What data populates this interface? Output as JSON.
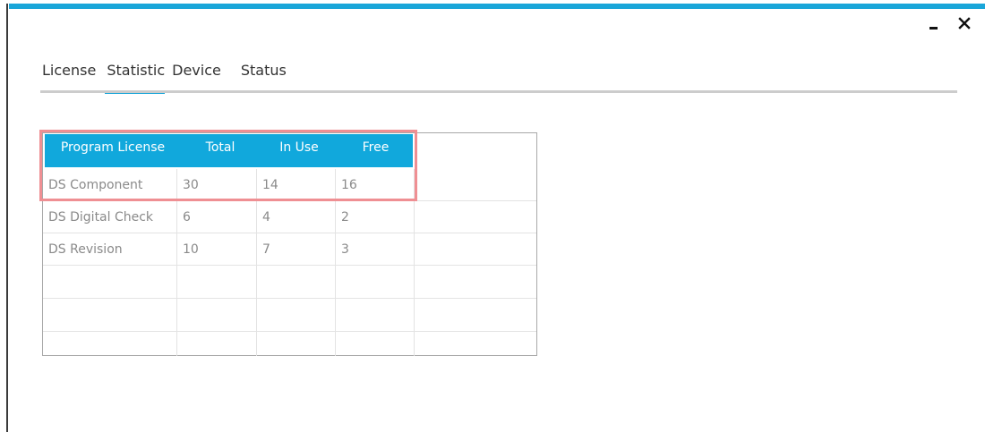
{
  "window": {
    "accent_color": "#1aa6d9",
    "minimize_glyph": "–",
    "close_glyph": "✕"
  },
  "tabs": [
    {
      "label": "License",
      "active": false
    },
    {
      "label": "Statistic",
      "active": true
    },
    {
      "label": "Device",
      "active": false
    },
    {
      "label": "Status",
      "active": false
    }
  ],
  "table": {
    "header_color": "#11a8dc",
    "highlight_color": "#ef8f93",
    "columns": [
      "Program License",
      "Total",
      "In Use",
      "Free"
    ],
    "rows": [
      {
        "program": "DS Component",
        "total": "30",
        "in_use": "14",
        "free": "16",
        "highlighted": true
      },
      {
        "program": "DS Digital Check",
        "total": "6",
        "in_use": "4",
        "free": "2",
        "highlighted": false
      },
      {
        "program": "DS Revision",
        "total": "10",
        "in_use": "7",
        "free": "3",
        "highlighted": false
      }
    ]
  }
}
